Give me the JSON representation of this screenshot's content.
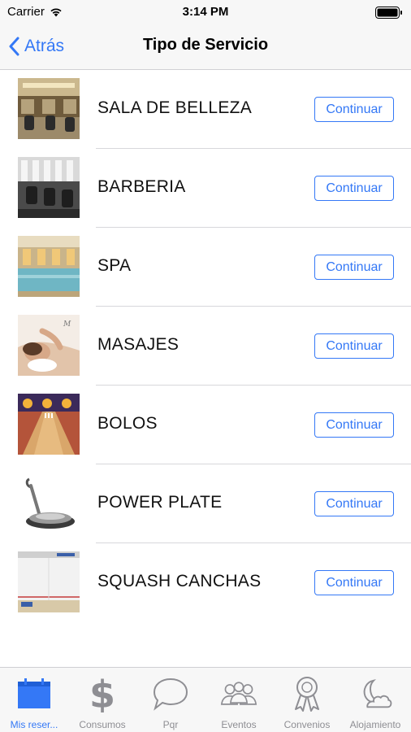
{
  "status_bar": {
    "carrier": "Carrier",
    "time": "3:14 PM"
  },
  "nav": {
    "back_label": "Atrás",
    "title": "Tipo de Servicio"
  },
  "services": [
    {
      "label": "SALA DE BELLEZA",
      "button": "Continuar",
      "image": "beauty-salon-photo"
    },
    {
      "label": "BARBERIA",
      "button": "Continuar",
      "image": "barbershop-photo"
    },
    {
      "label": "SPA",
      "button": "Continuar",
      "image": "spa-pool-photo"
    },
    {
      "label": "MASAJES",
      "button": "Continuar",
      "image": "massage-photo"
    },
    {
      "label": "BOLOS",
      "button": "Continuar",
      "image": "bowling-lanes-photo"
    },
    {
      "label": "POWER PLATE",
      "button": "Continuar",
      "image": "power-plate-machine-photo"
    },
    {
      "label": "SQUASH CANCHAS",
      "button": "Continuar",
      "image": "squash-court-photo"
    }
  ],
  "tabs": [
    {
      "label": "Mis reser...",
      "icon": "calendar-icon",
      "active": true
    },
    {
      "label": "Consumos",
      "icon": "dollar-icon",
      "active": false
    },
    {
      "label": "Pqr",
      "icon": "speech-bubble-icon",
      "active": false
    },
    {
      "label": "Eventos",
      "icon": "people-icon",
      "active": false
    },
    {
      "label": "Convenios",
      "icon": "award-icon",
      "active": false
    },
    {
      "label": "Alojamiento",
      "icon": "moon-cloud-icon",
      "active": false
    }
  ],
  "colors": {
    "accent": "#3478f6",
    "inactive": "#8e8e93",
    "bar_bg": "#f7f7f7"
  }
}
